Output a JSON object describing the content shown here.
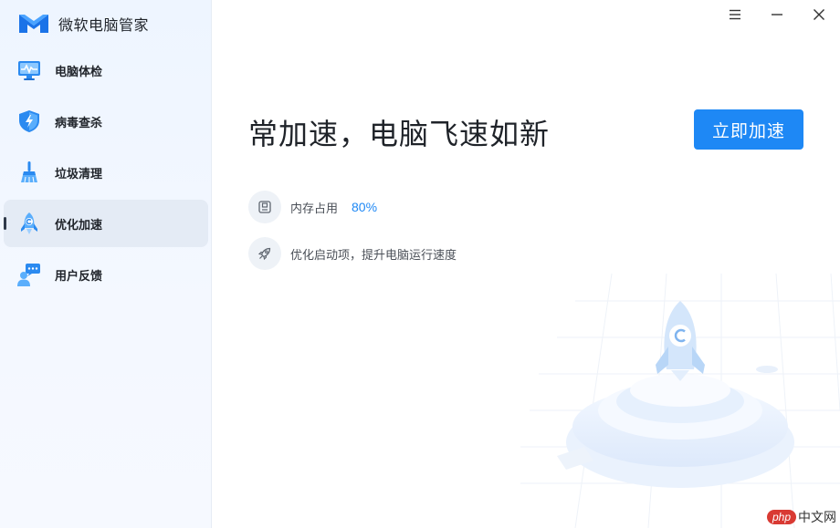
{
  "app": {
    "title": "微软电脑管家"
  },
  "sidebar": {
    "items": [
      {
        "label": "电脑体检",
        "icon": "monitor-pulse-icon"
      },
      {
        "label": "病毒查杀",
        "icon": "shield-lightning-icon"
      },
      {
        "label": "垃圾清理",
        "icon": "broom-icon"
      },
      {
        "label": "优化加速",
        "icon": "rocket-icon",
        "active": true
      },
      {
        "label": "用户反馈",
        "icon": "user-chat-icon"
      }
    ]
  },
  "window": {
    "controls": [
      "menu-icon",
      "minimize-icon",
      "close-icon"
    ]
  },
  "main": {
    "headline": "常加速，电脑飞速如新",
    "cta_label": "立即加速",
    "memory": {
      "label": "内存占用",
      "value": "80%",
      "icon": "memory-chip-icon"
    },
    "startup": {
      "label": "优化启动项，提升电脑运行速度",
      "icon": "rocket-outline-icon"
    }
  },
  "watermark": {
    "logo": "php",
    "text": "中文网"
  },
  "colors": {
    "accent": "#1e88f5",
    "sidebar_bg": "#eef5ff",
    "active_bg": "#e4ebf5"
  }
}
